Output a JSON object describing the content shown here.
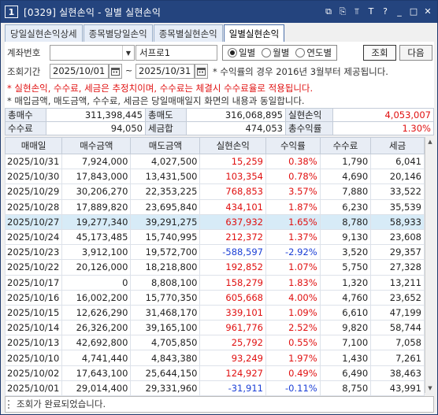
{
  "window": {
    "number": "1",
    "title": "[0329] 실현손익 - 일별 실현손익"
  },
  "titlebar_icons": [
    "window-icon",
    "link-icon",
    "pin-icon",
    "text-icon",
    "help-icon",
    "minimize-icon",
    "maximize-icon",
    "close-icon"
  ],
  "titlebar_glyphs": {
    "window": "⧉",
    "link": "⎘",
    "pin": "⫪",
    "text": "T",
    "help": "?",
    "minimize": "_",
    "maximize": "□",
    "close": "✕"
  },
  "tabs": [
    {
      "label": "당일실현손익상세",
      "active": false
    },
    {
      "label": "종목별당일손익",
      "active": false
    },
    {
      "label": "종목별실현손익",
      "active": false
    },
    {
      "label": "일별실현손익",
      "active": true
    }
  ],
  "form": {
    "account_label": "계좌번호",
    "account_name": "서프로1",
    "radios": [
      {
        "label": "일별",
        "checked": true
      },
      {
        "label": "월별",
        "checked": false
      },
      {
        "label": "연도별",
        "checked": false
      }
    ],
    "query_button": "조회",
    "next_button": "다음",
    "period_label": "조회기간",
    "date_from": "2025/10/01",
    "date_sep": "~",
    "date_to": "2025/10/31",
    "note": "* 수익률의 경우 2016년 3월부터 제공됩니다.",
    "warning": "* 실현손익, 수수료, 세금은 추정치이며, 수수료는 체결시 수수료율로 적용됩니다.",
    "info": "* 매입금액, 매도금액, 수수료, 세금은 당일매매일지 화면의 내용과 동일합니다."
  },
  "summary": {
    "buy_label": "총매수",
    "buy_value": "311,398,445",
    "sell_label": "총매도",
    "sell_value": "316,068,895",
    "pnl_label": "실현손익",
    "pnl_value": "4,053,007",
    "fee_label": "수수료",
    "fee_value": "94,050",
    "tax_label": "세금합",
    "tax_value": "474,053",
    "rate_label": "총수익률",
    "rate_value": "1.30%"
  },
  "columns": [
    "매매일",
    "매수금액",
    "매도금액",
    "실현손익",
    "수익률",
    "수수료",
    "세금"
  ],
  "rows": [
    {
      "date": "2025/10/31",
      "buy": "7,924,000",
      "sell": "4,027,500",
      "pnl": "15,259",
      "rate": "0.38%",
      "fee": "1,790",
      "tax": "6,041",
      "sign": "pos"
    },
    {
      "date": "2025/10/30",
      "buy": "17,843,000",
      "sell": "13,431,500",
      "pnl": "103,354",
      "rate": "0.78%",
      "fee": "4,690",
      "tax": "20,146",
      "sign": "pos"
    },
    {
      "date": "2025/10/29",
      "buy": "30,206,270",
      "sell": "22,353,225",
      "pnl": "768,853",
      "rate": "3.57%",
      "fee": "7,880",
      "tax": "33,522",
      "sign": "pos"
    },
    {
      "date": "2025/10/28",
      "buy": "17,889,820",
      "sell": "23,695,840",
      "pnl": "434,101",
      "rate": "1.87%",
      "fee": "6,230",
      "tax": "35,539",
      "sign": "pos"
    },
    {
      "date": "2025/10/27",
      "buy": "19,277,340",
      "sell": "39,291,275",
      "pnl": "637,932",
      "rate": "1.65%",
      "fee": "8,780",
      "tax": "58,933",
      "sign": "pos",
      "selected": true
    },
    {
      "date": "2025/10/24",
      "buy": "45,173,485",
      "sell": "15,740,995",
      "pnl": "212,372",
      "rate": "1.37%",
      "fee": "9,130",
      "tax": "23,608",
      "sign": "pos"
    },
    {
      "date": "2025/10/23",
      "buy": "3,912,100",
      "sell": "19,572,700",
      "pnl": "-588,597",
      "rate": "-2.92%",
      "fee": "3,520",
      "tax": "29,357",
      "sign": "neg"
    },
    {
      "date": "2025/10/22",
      "buy": "20,126,000",
      "sell": "18,218,800",
      "pnl": "192,852",
      "rate": "1.07%",
      "fee": "5,750",
      "tax": "27,328",
      "sign": "pos"
    },
    {
      "date": "2025/10/17",
      "buy": "0",
      "sell": "8,808,100",
      "pnl": "158,279",
      "rate": "1.83%",
      "fee": "1,320",
      "tax": "13,211",
      "sign": "pos"
    },
    {
      "date": "2025/10/16",
      "buy": "16,002,200",
      "sell": "15,770,350",
      "pnl": "605,668",
      "rate": "4.00%",
      "fee": "4,760",
      "tax": "23,652",
      "sign": "pos"
    },
    {
      "date": "2025/10/15",
      "buy": "12,626,290",
      "sell": "31,468,170",
      "pnl": "339,101",
      "rate": "1.09%",
      "fee": "6,610",
      "tax": "47,199",
      "sign": "pos"
    },
    {
      "date": "2025/10/14",
      "buy": "26,326,200",
      "sell": "39,165,100",
      "pnl": "961,776",
      "rate": "2.52%",
      "fee": "9,820",
      "tax": "58,744",
      "sign": "pos"
    },
    {
      "date": "2025/10/13",
      "buy": "42,692,800",
      "sell": "4,705,850",
      "pnl": "25,792",
      "rate": "0.55%",
      "fee": "7,100",
      "tax": "7,058",
      "sign": "pos"
    },
    {
      "date": "2025/10/10",
      "buy": "4,741,440",
      "sell": "4,843,380",
      "pnl": "93,249",
      "rate": "1.97%",
      "fee": "1,430",
      "tax": "7,261",
      "sign": "pos"
    },
    {
      "date": "2025/10/02",
      "buy": "17,643,100",
      "sell": "25,644,150",
      "pnl": "124,927",
      "rate": "0.49%",
      "fee": "6,490",
      "tax": "38,463",
      "sign": "pos"
    },
    {
      "date": "2025/10/01",
      "buy": "29,014,400",
      "sell": "29,331,960",
      "pnl": "-31,911",
      "rate": "-0.11%",
      "fee": "8,750",
      "tax": "43,991",
      "sign": "neg"
    }
  ],
  "status": "조회가 완료되었습니다.",
  "colors": {
    "titlebar": "#24447e",
    "positive": "#e01010",
    "negative": "#1b3fd6",
    "selected_row": "#d7ebf7",
    "header_bg": "#e8edf5"
  }
}
